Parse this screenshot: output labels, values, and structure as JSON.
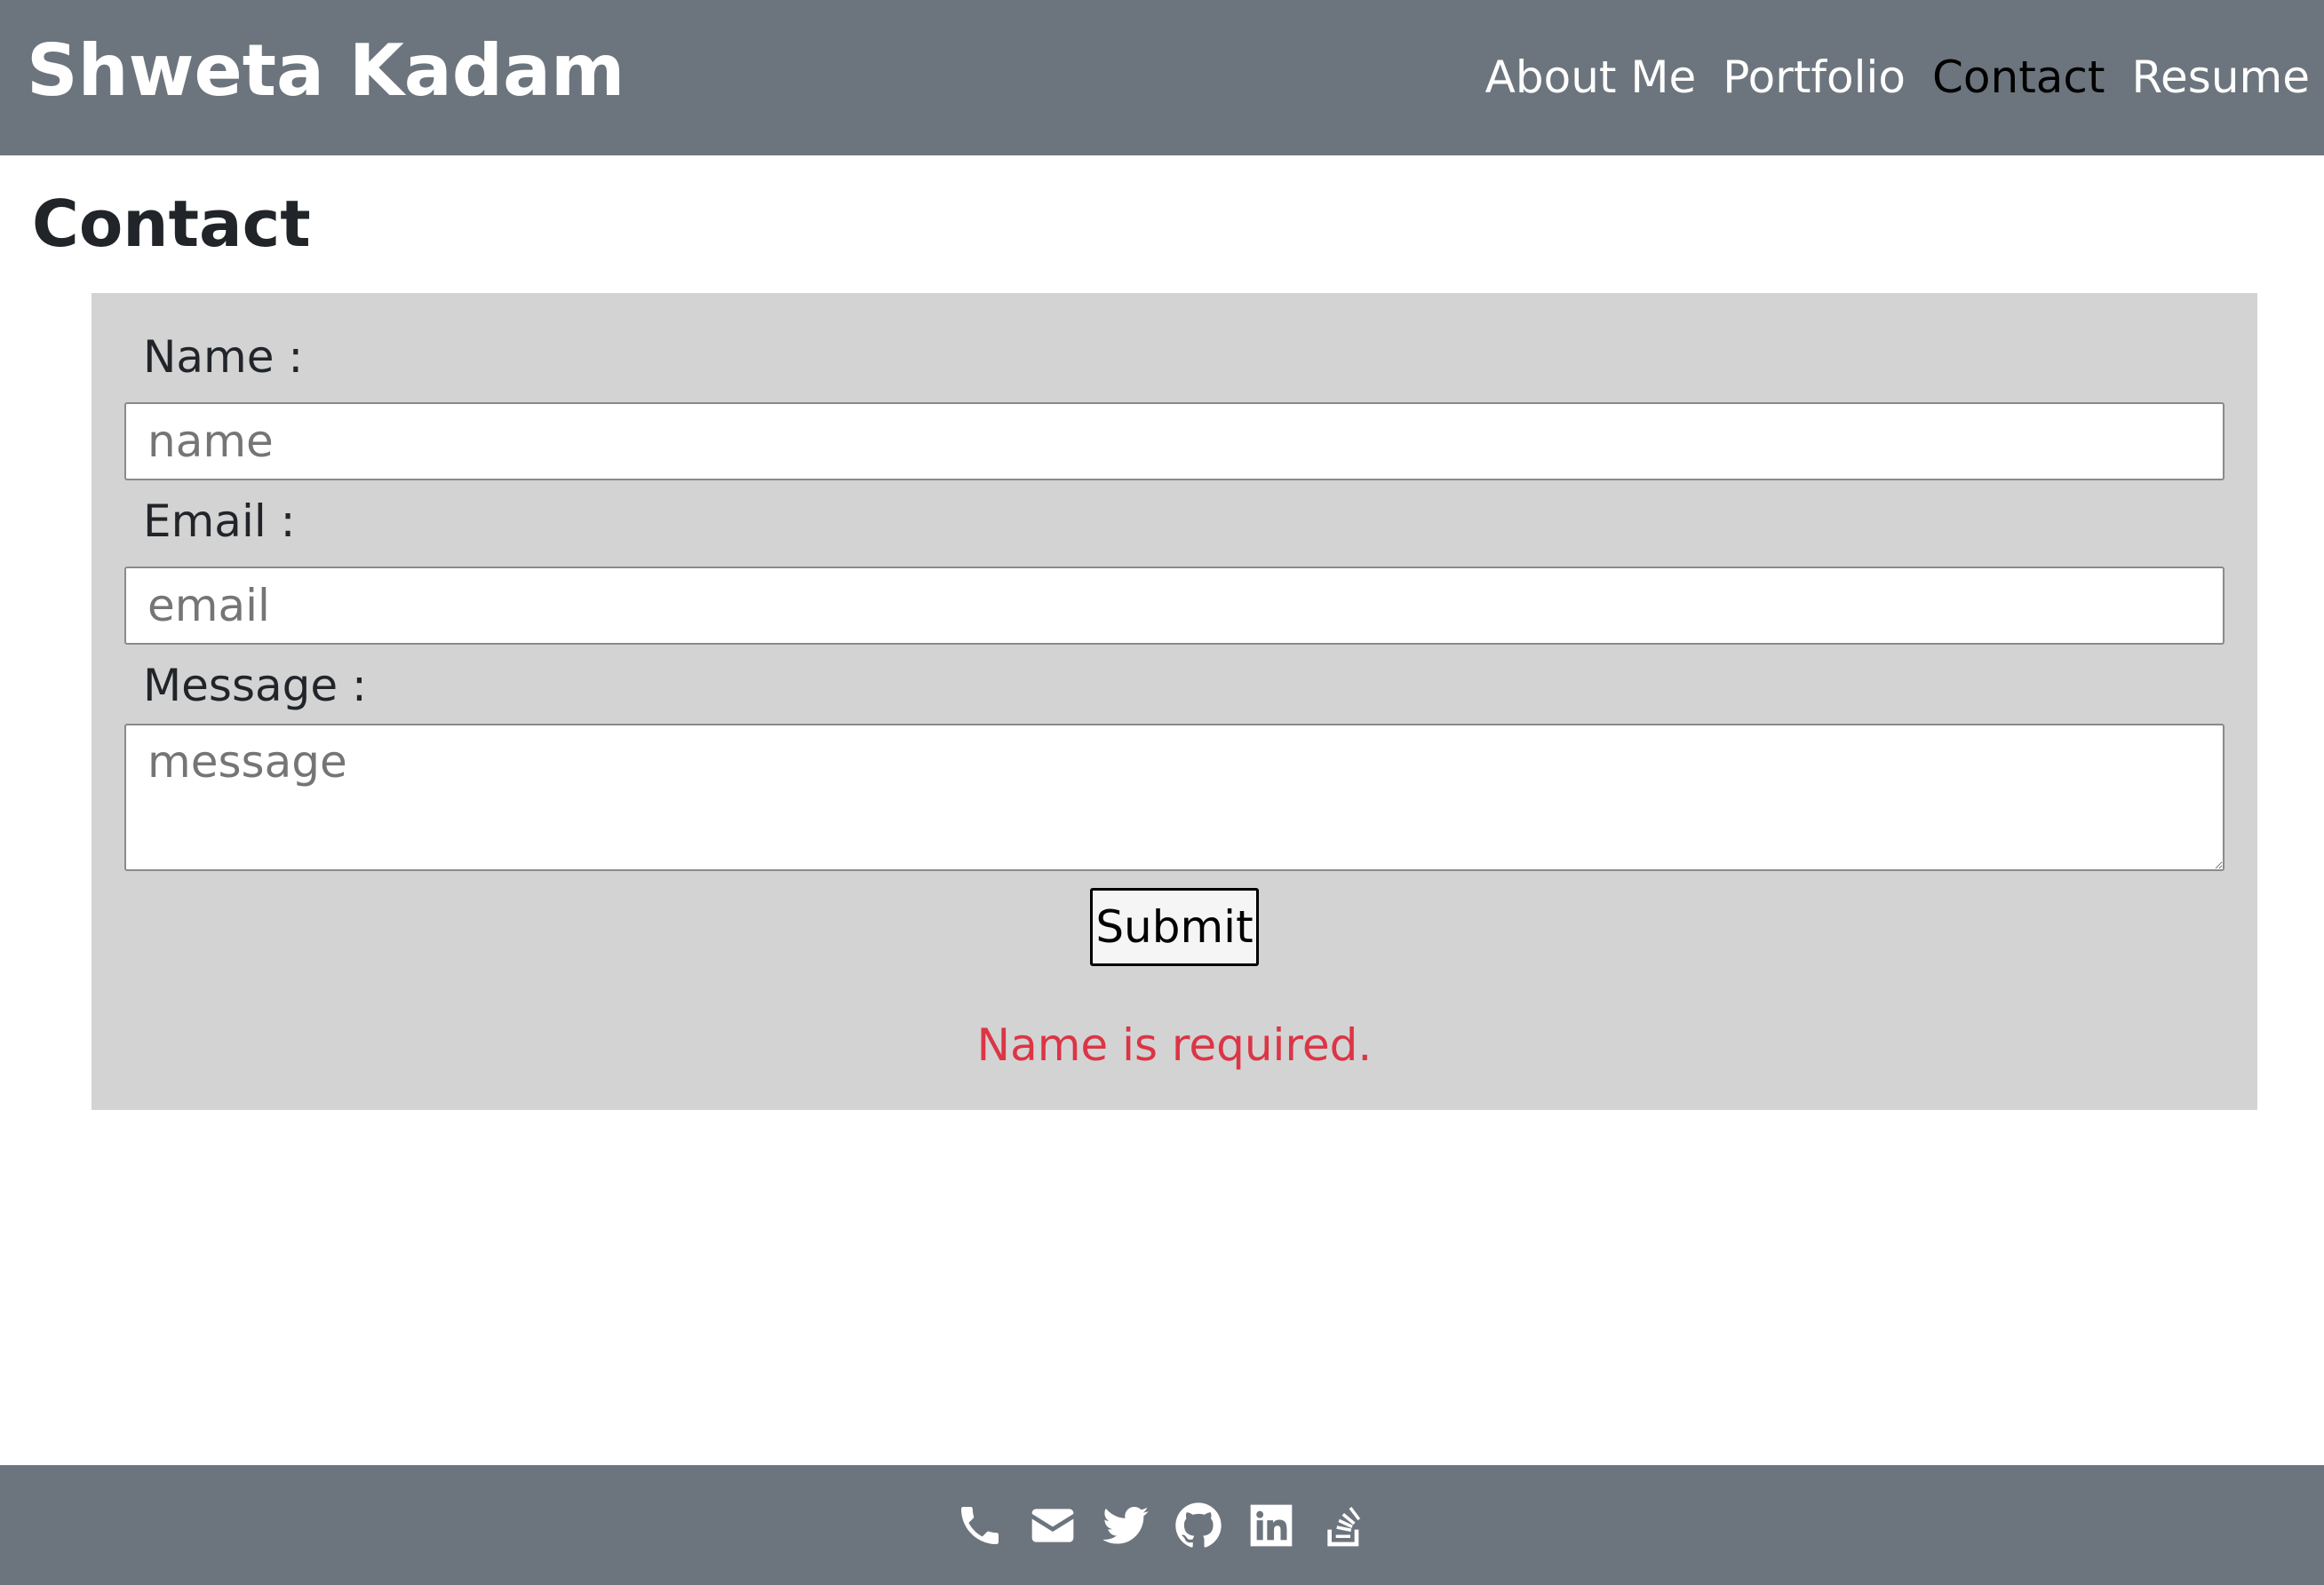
{
  "header": {
    "brand": "Shweta Kadam",
    "nav": [
      {
        "label": "About Me",
        "active": false
      },
      {
        "label": "Portfolio",
        "active": false
      },
      {
        "label": "Contact",
        "active": true
      },
      {
        "label": "Resume",
        "active": false
      }
    ]
  },
  "page": {
    "title": "Contact"
  },
  "form": {
    "name_label": "Name :",
    "name_placeholder": "name",
    "email_label": "Email :",
    "email_placeholder": "email",
    "message_label": "Message :",
    "message_placeholder": "message",
    "submit_label": "Submit",
    "error": "Name is required."
  },
  "footer": {
    "icons": [
      "phone-icon",
      "envelope-icon",
      "twitter-icon",
      "github-icon",
      "linkedin-icon",
      "stack-overflow-icon"
    ]
  },
  "colors": {
    "header_bg": "#6c757d",
    "panel_bg": "#d3d3d3",
    "error": "#dc3545",
    "active_nav": "#000000"
  }
}
